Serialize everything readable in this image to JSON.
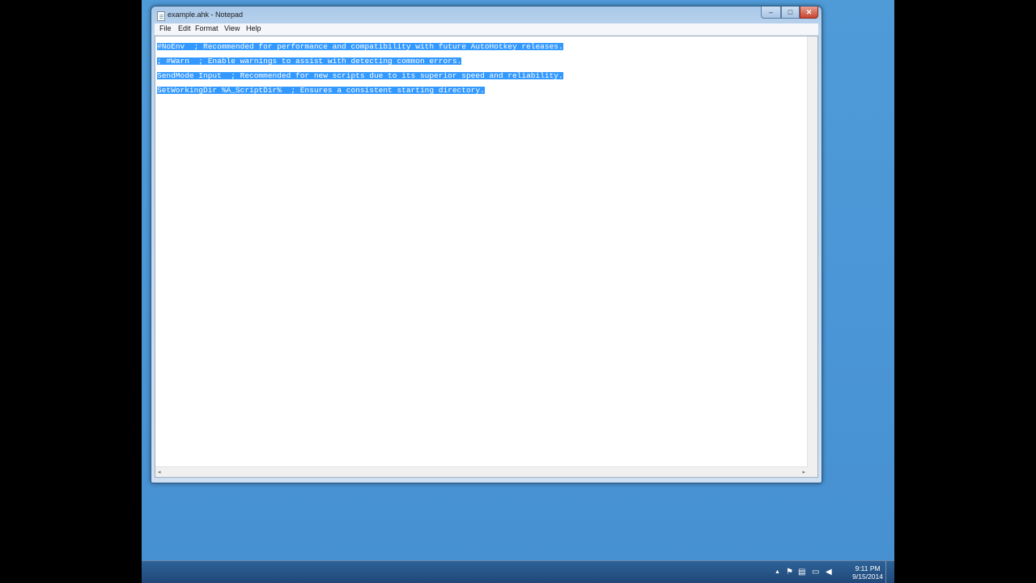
{
  "window": {
    "title": "example.ahk - Notepad",
    "controls": {
      "minimize": "–",
      "maximize": "□",
      "close": "✕"
    }
  },
  "menu": [
    "File",
    "Edit",
    "Format",
    "View",
    "Help"
  ],
  "editor": {
    "lines": [
      "#NoEnv  ; Recommended for performance and compatibility with future AutoHotkey releases.",
      "; #Warn  ; Enable warnings to assist with detecting common errors.",
      "SendMode Input  ; Recommended for new scripts due to its superior speed and reliability.",
      "SetWorkingDir %A_ScriptDir%  ; Ensures a consistent starting directory."
    ],
    "selection_color": "#3399ff"
  },
  "scrollbar": {
    "left_arrow": "◂",
    "right_arrow": "▸"
  },
  "taskbar": {
    "tray_icons": [
      "up-arrow-icon",
      "flag-icon",
      "network-icon",
      "display-icon",
      "volume-icon"
    ],
    "tray_glyphs": [
      "▲",
      "⚑",
      "▤",
      "▭",
      "◀"
    ],
    "time": "9:11 PM",
    "date": "9/15/2014"
  }
}
